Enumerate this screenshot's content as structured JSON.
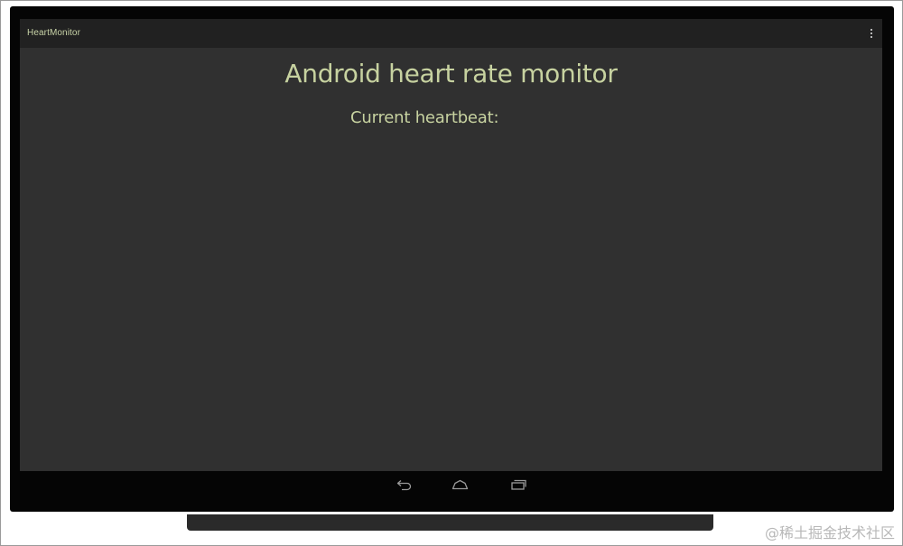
{
  "app": {
    "title": "HeartMonitor"
  },
  "action_bar": {
    "overflow_icon": "overflow-menu-icon"
  },
  "content": {
    "title": "Android heart rate monitor",
    "heartbeat_label": "Current heartbeat:"
  },
  "navigation_bar": {
    "back_icon": "back-icon",
    "home_icon": "home-icon",
    "recents_icon": "recents-icon"
  },
  "watermark": {
    "text": "@稀土掘金技术社区"
  },
  "colors": {
    "screen_background": "#303030",
    "action_bar_background": "#212121",
    "accent_text": "#c7d2a0",
    "device_bezel": "#050505"
  }
}
